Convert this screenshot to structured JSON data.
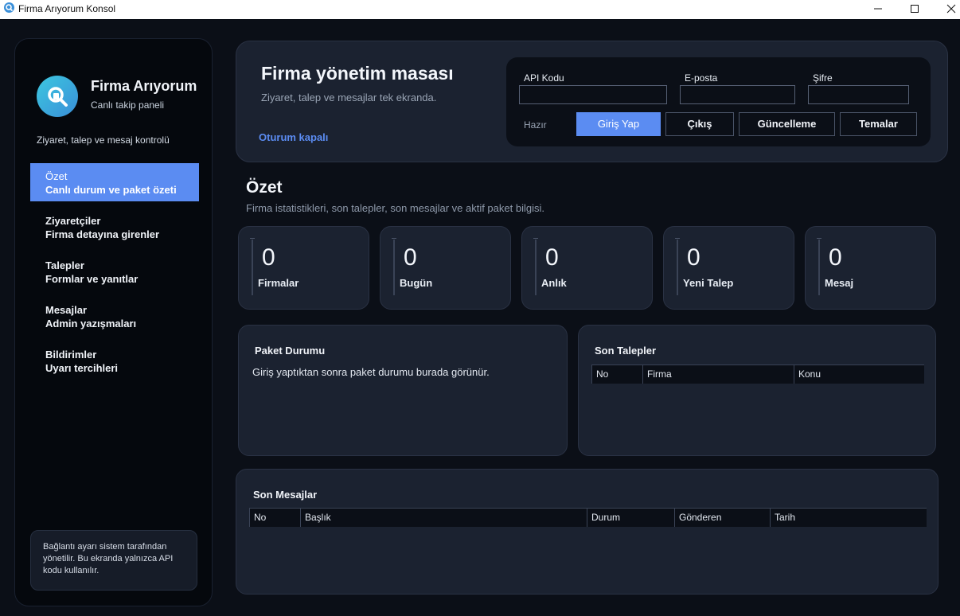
{
  "window": {
    "title": "Firma Arıyorum Konsol",
    "min_label": "—",
    "max_label": "☐",
    "close_label": "✕"
  },
  "sidebar": {
    "brand_name": "Firma Arıyorum",
    "brand_sub": "Canlı takip paneli",
    "description": "Ziyaret, talep ve mesaj kontrolü",
    "items": [
      {
        "label": "Özet",
        "sub": "Canlı durum ve paket özeti"
      },
      {
        "label": "Ziyaretçiler",
        "sub": "Firma detayına girenler"
      },
      {
        "label": "Talepler",
        "sub": "Formlar ve yanıtlar"
      },
      {
        "label": "Mesajlar",
        "sub": "Admin yazışmaları"
      },
      {
        "label": "Bildirimler",
        "sub": "Uyarı tercihleri"
      }
    ],
    "note": "Bağlantı ayarı sistem tarafından yönetilir. Bu ekranda yalnızca API kodu kullanılır."
  },
  "header": {
    "title": "Firma yönetim masası",
    "subtitle": "Ziyaret, talep ve mesajlar tek ekranda.",
    "session_status": "Oturum kapalı"
  },
  "login": {
    "api_label": "API Kodu",
    "api_value": "",
    "email_label": "E-posta",
    "email_value": "",
    "password_label": "Şifre",
    "password_value": "",
    "status": "Hazır",
    "login_button": "Giriş Yap",
    "logout_button": "Çıkış",
    "update_button": "Güncelleme",
    "themes_button": "Temalar"
  },
  "summary": {
    "title": "Özet",
    "subtitle": "Firma istatistikleri, son talepler, son mesajlar ve aktif paket bilgisi.",
    "stats": [
      {
        "value": "0",
        "label": "Firmalar"
      },
      {
        "value": "0",
        "label": "Bugün"
      },
      {
        "value": "0",
        "label": "Anlık"
      },
      {
        "value": "0",
        "label": "Yeni Talep"
      },
      {
        "value": "0",
        "label": "Mesaj"
      }
    ]
  },
  "package_panel": {
    "title": "Paket Durumu",
    "text": "Giriş yaptıktan sonra paket durumu burada görünür."
  },
  "requests_panel": {
    "title": "Son Talepler",
    "columns": [
      "No",
      "Firma",
      "Konu"
    ]
  },
  "messages_panel": {
    "title": "Son Mesajlar",
    "columns": [
      "No",
      "Başlık",
      "Durum",
      "Gönderen",
      "Tarih"
    ]
  },
  "colors": {
    "accent": "#5b8cf2",
    "background": "#0b0f17",
    "card": "#1b2230",
    "logo_gradient_start": "#3cc7df",
    "logo_gradient_end": "#3a8fd9"
  }
}
